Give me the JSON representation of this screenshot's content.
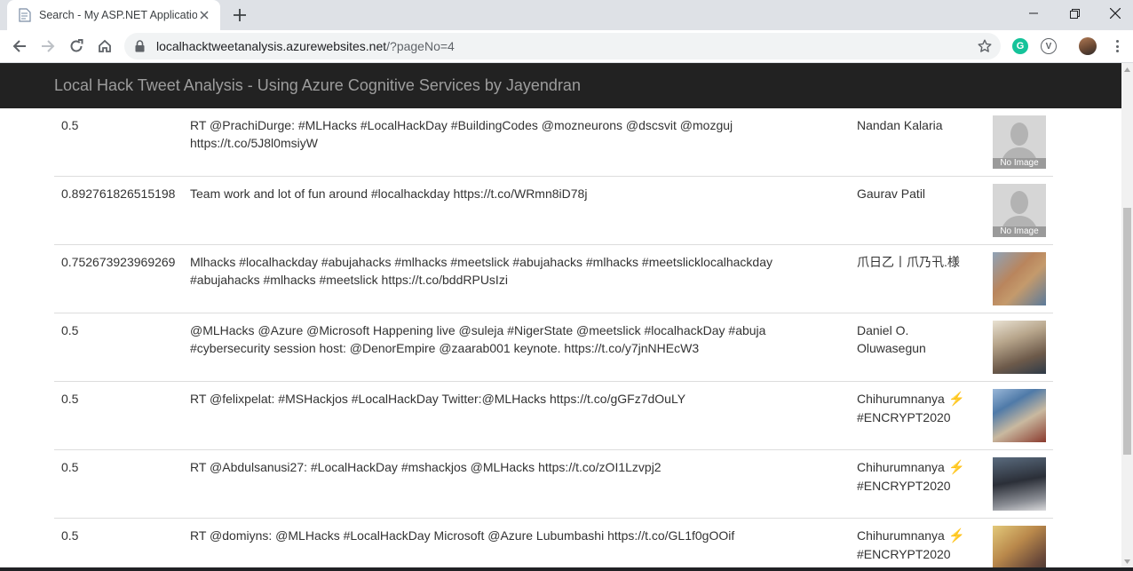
{
  "browser": {
    "tab_title": "Search - My ASP.NET Application",
    "url_host": "localhacktweetanalysis.azurewebsites.net",
    "url_path": "/?pageNo=4",
    "icons": [
      "file-icon",
      "close-icon",
      "plus-icon",
      "back-icon",
      "forward-icon",
      "reload-icon",
      "home-icon",
      "lock-icon",
      "star-icon",
      "grammarly-icon",
      "vivaldi-icon",
      "profile-avatar",
      "menu-icon"
    ]
  },
  "page": {
    "brand": "Local Hack Tweet Analysis - Using Azure Cognitive Services by Jayendran",
    "no_image_label": "No Image",
    "rows": [
      {
        "score": "0.5",
        "text": "RT @PrachiDurge: #MLHacks #LocalHackDay #BuildingCodes @mozneurons @dscsvit @mozguj https://t.co/5J8l0msiyW",
        "user": "Nandan Kalaria",
        "user_tag": "",
        "image": "no-image"
      },
      {
        "score": "0.892761826515198",
        "text": "Team work and lot of fun around #localhackday https://t.co/WRmn8iD78j",
        "user": "Gaurav Patil",
        "user_tag": "",
        "image": "no-image"
      },
      {
        "score": "0.752673923969269",
        "text": "Mlhacks #localhackday #abujahacks #mlhacks #meetslick #abujahacks #mlhacks #meetslicklocalhackday #abujahacks #mlhacks #meetslick https://t.co/bddRPUsIzi",
        "user": "爪日乙丨爪乃卂.様",
        "user_tag": "",
        "image": "photo"
      },
      {
        "score": "0.5",
        "text": "@MLHacks @Azure @Microsoft Happening live @suleja #NigerState @meetslick #localhackDay #abuja #cybersecurity session host: @DenorEmpire @zaarab001 keynote. https://t.co/y7jnNHEcW3",
        "user": "Daniel O. Oluwasegun",
        "user_tag": "",
        "image": "photo"
      },
      {
        "score": "0.5",
        "text": "RT @felixpelat: #MSHackjos #LocalHackDay Twitter:@MLHacks https://t.co/gGFz7dOuLY",
        "user": "Chihurumnanya",
        "user_tag": "#ENCRYPT2020",
        "image": "photo"
      },
      {
        "score": "0.5",
        "text": "RT @Abdulsanusi27: #LocalHackDay #mshackjos @MLHacks https://t.co/zOI1Lzvpj2",
        "user": "Chihurumnanya",
        "user_tag": "#ENCRYPT2020",
        "image": "photo"
      },
      {
        "score": "0.5",
        "text": "RT @domiyns: @MLHacks #LocalHackDay Microsoft @Azure Lubumbashi https://t.co/GL1f0gOOif",
        "user": "Chihurumnanya",
        "user_tag": "#ENCRYPT2020",
        "image": "photo"
      }
    ]
  },
  "colors": {
    "navbar_bg": "#222222",
    "brand_text": "#9d9d9d",
    "row_border": "#dddddd",
    "body_text": "#333333"
  }
}
